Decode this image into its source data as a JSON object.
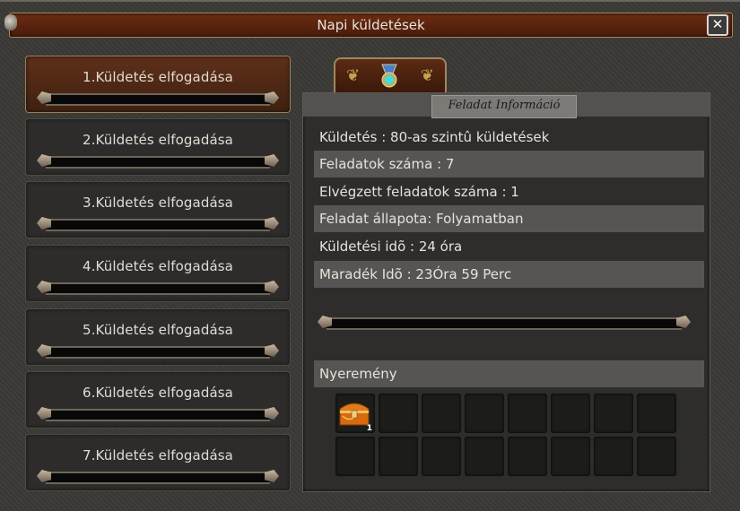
{
  "window": {
    "title": "Napi küldetések",
    "close_symbol": "✕"
  },
  "quests": [
    {
      "label": "1.Küldetés elfogadása",
      "active": true
    },
    {
      "label": "2.Küldetés elfogadása",
      "active": false
    },
    {
      "label": "3.Küldetés elfogadása",
      "active": false
    },
    {
      "label": "4.Küldetés elfogadása",
      "active": false
    },
    {
      "label": "5.Küldetés elfogadása",
      "active": false
    },
    {
      "label": "6.Küldetés elfogadása",
      "active": false
    },
    {
      "label": "7.Küldetés elfogadása",
      "active": false
    }
  ],
  "tab": {
    "icon": "medal-icon"
  },
  "info": {
    "header": "Feladat Információ",
    "rows": [
      "Küldetés : 80-as szintû küldetések",
      "Feladatok száma : 7",
      "Elvégzett feladatok száma : 1",
      "Feladat állapota: Folyamatban",
      "Küldetési idõ : 24 óra",
      "Maradék Idõ : 23Óra 59 Perc"
    ]
  },
  "reward": {
    "header": "Nyeremény",
    "items": [
      {
        "icon": "treasure-chest-icon",
        "count": "1"
      }
    ]
  }
}
